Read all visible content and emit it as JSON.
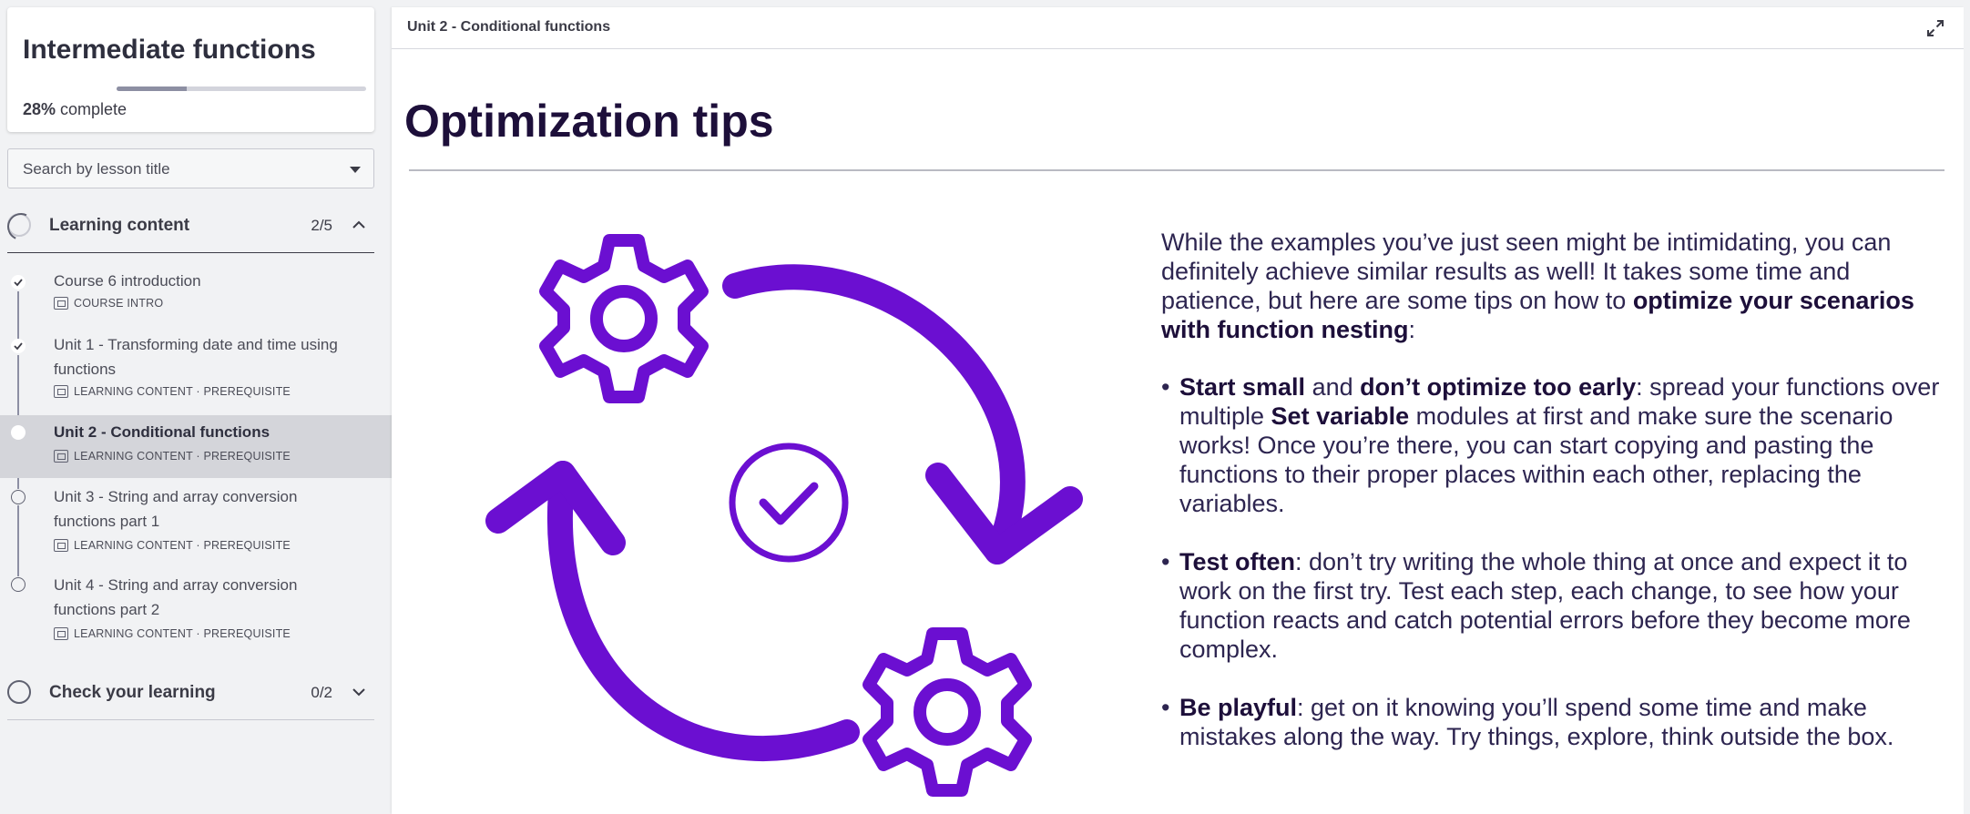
{
  "sidebar": {
    "course_title": "Intermediate functions",
    "progress": {
      "value": 28,
      "percent_label": "28%",
      "suffix": " complete"
    },
    "search": {
      "placeholder": "Search by lesson title"
    },
    "sections": [
      {
        "label": "Learning content",
        "count": "2/5",
        "expanded": true,
        "lessons": [
          {
            "title": "Course 6 introduction",
            "meta": "COURSE INTRO",
            "status": "done"
          },
          {
            "title": "Unit 1 - Transforming date and time using functions",
            "meta": "LEARNING CONTENT · PREREQUISITE",
            "status": "done"
          },
          {
            "title": "Unit 2 - Conditional functions",
            "meta": "LEARNING CONTENT · PREREQUISITE",
            "status": "current"
          },
          {
            "title": "Unit 3 - String and array conversion functions part 1",
            "meta": "LEARNING CONTENT · PREREQUISITE",
            "status": "todo"
          },
          {
            "title": "Unit 4 - String and array conversion functions part 2",
            "meta": "LEARNING CONTENT · PREREQUISITE",
            "status": "todo"
          }
        ]
      },
      {
        "label": "Check your learning",
        "count": "0/2",
        "expanded": false
      }
    ]
  },
  "main": {
    "breadcrumb": "Unit 2 - Conditional functions",
    "title": "Optimization tips",
    "intro": {
      "text": "While the examples you’ve just seen might be intimidating, you can definitely achieve similar results as well! It takes some time and patience, but here are some tips on how to ",
      "bold": "optimize your scenarios with function nesting",
      "end": ":"
    },
    "tips": [
      {
        "b1": "Start small",
        "t1": " and ",
        "b2": "don’t optimize too early",
        "t2": ": spread your functions over multiple ",
        "b3": "Set variable",
        "t3": " modules at first and make sure the scenario works! Once you’re there, you can start copying and pasting the functions to their proper places within each other, replacing the variables."
      },
      {
        "b1": "Test often",
        "t1": ": don’t try writing the whole thing at once and expect it to work on the first try. Test each step, each change, to see how your function reacts and catch potential errors before they become more complex."
      },
      {
        "b1": "Be playful",
        "t1": ": get on it knowing you’ll spend some time and make mistakes along the way. Try things, explore, think outside the box."
      }
    ]
  },
  "colors": {
    "accent_purple": "#6b0fd1",
    "title_dark": "#1d0f3a",
    "sidebar_bg": "#f1f2f4",
    "active_row": "#d4d5da"
  },
  "icons": {
    "expand": "expand-icon",
    "caret": "caret-down-icon",
    "chevron_up": "chevron-up-icon",
    "chevron_down": "chevron-down-icon",
    "check": "check-icon"
  }
}
